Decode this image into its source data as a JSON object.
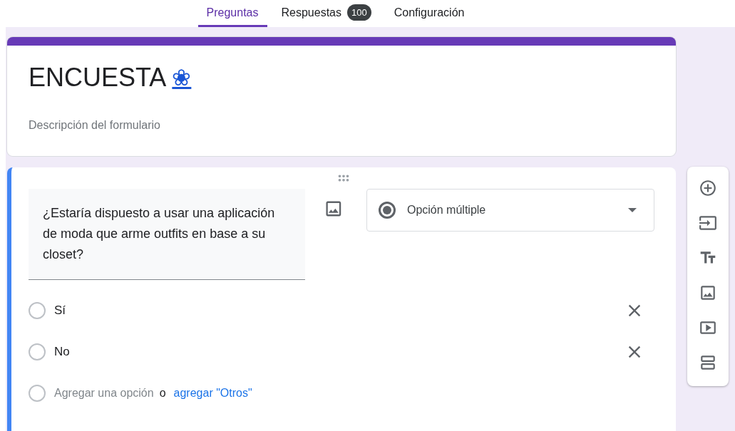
{
  "tabs": [
    {
      "label": "Preguntas",
      "selected": true
    },
    {
      "label": "Respuestas",
      "selected": false,
      "badge": "100"
    },
    {
      "label": "Configuración",
      "selected": false
    }
  ],
  "form": {
    "title": "ENCUESTA",
    "title_symbol": "❀",
    "description_placeholder": "Descripción del formulario"
  },
  "question": {
    "text": "¿Estaría dispuesto a usar una aplicación de moda que arme outfits en base a su closet?",
    "type": "Opción múltiple",
    "options": [
      {
        "label": "Sí"
      },
      {
        "label": "No"
      }
    ],
    "add_option": "Agregar una opción",
    "or": "o",
    "add_other": "agregar \"Otros\""
  },
  "toolbar": [
    {
      "kind": "add"
    },
    {
      "kind": "import"
    },
    {
      "kind": "title"
    },
    {
      "kind": "image"
    },
    {
      "kind": "video"
    },
    {
      "kind": "section"
    }
  ]
}
